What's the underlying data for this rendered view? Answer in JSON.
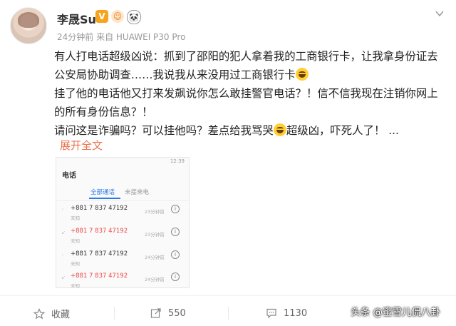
{
  "user": {
    "name": "李晟Su",
    "meta": "24分钟前  来自 HUAWEI P30 Pro"
  },
  "post": {
    "lines": [
      "有人打电话超级凶说：抓到了邵阳的犯人拿着我的工商银行卡，让我拿身份证去公安局协助调查……我说我从来没用过工商银行卡",
      "挂了他的电话他又打来发飙说你怎么敢挂警官电话？！信不信我现在注销你网上的所有身份信息？！",
      "请问这是诈骗吗？可以挂他吗？差点给我骂哭",
      "超级凶，吓死人了！ ..."
    ],
    "expand_label": "展开全文"
  },
  "screenshot": {
    "statusbar_time": "12:39",
    "title": "电话",
    "tabs": [
      "全部通话",
      "未接来电"
    ],
    "calls": [
      {
        "number": "+881 7 837 47192",
        "sub": "未知",
        "time": "23分钟前",
        "missed": false
      },
      {
        "number": "+881 7 837 47192",
        "sub": "未知",
        "time": "23分钟前",
        "missed": true
      },
      {
        "number": "+881 7 837 47192",
        "sub": "未知",
        "time": "24分钟前",
        "missed": false
      },
      {
        "number": "+881 7 837 47192",
        "sub": "未知",
        "time": "24分钟前",
        "missed": true
      }
    ]
  },
  "actions": {
    "favorite_label": "收藏",
    "repost_count": "550",
    "comment_count": "1130",
    "like_count": ""
  },
  "watermark": "头条 @蜜雪儿侃八卦",
  "colors": {
    "accent": "#eb7350",
    "missed_call": "#e44444",
    "tab_active": "#2a7be4"
  }
}
